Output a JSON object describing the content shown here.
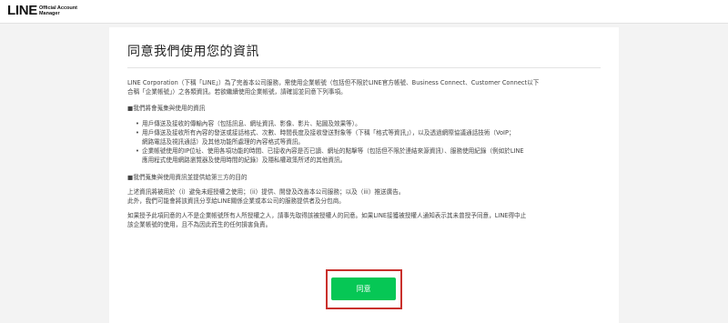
{
  "header": {
    "logo_main": "LINE",
    "logo_sub_line1": "Official Account",
    "logo_sub_line2": "Manager"
  },
  "page": {
    "title": "同意我們使用您的資訊"
  },
  "content": {
    "intro_line1": "LINE Corporation（下稱「LINE」）為了完善本公司服務，需使用企業帳號（包括但不限於LINE官方帳號、Business Connect、Customer Connect以下",
    "intro_line2": "合稱「企業帳號」）之各類資訊。若欲繼續使用企業帳號，請確認並同意下列事項。",
    "section1_heading": "■我們將會蒐集與使用的資訊",
    "section1_items": [
      "用戶傳送及接收的傳輸內容（包括訊息、網址資訊、影像、影片、貼圖及效果等）。",
      "用戶傳送及接收所有內容的發送或接話格式、次數、時間長度及接收發送對象等（下稱「格式等資訊」），以及透過網際協議通話技術（VoIP；",
      "網路電話及視訊通話）及其他功能所處理的內容格式等資訊。",
      "企業帳號使用的IP位址、使用各項功能的時間、已接收內容是否已讀、網址的點擊等（包括但不限於連結來源資訊）、服務使用紀錄（例如於LINE",
      "應用程式使用網路瀏覽器及使用時間的紀錄）及隱私權政策所述的其他資訊。"
    ],
    "section2_heading": "■我們蒐集與使用資訊並提供給第三方的目的",
    "section2_line1": "上述資訊將被用於（i）避免未經授權之使用；（ii）提供、開發及改善本公司服務；以及（iii）推送廣告。",
    "section2_line2": "此外，我們可能會將該資訊分享給LINE關係企業或本公司的服務提供者及分包商。",
    "closing_line1": "如果授予此項同意的人不是企業帳號所有人所授權之人，請事先取得該被授權人的同意。如果LINE接獲被授權人通知表示其未曾授予同意，LINE得中止",
    "closing_line2": "該企業帳號的使用，且不為因此而生的任何損害負責。"
  },
  "actions": {
    "agree_label": "同意"
  },
  "colors": {
    "accent": "#06c755",
    "highlight_frame": "#c9302c"
  }
}
